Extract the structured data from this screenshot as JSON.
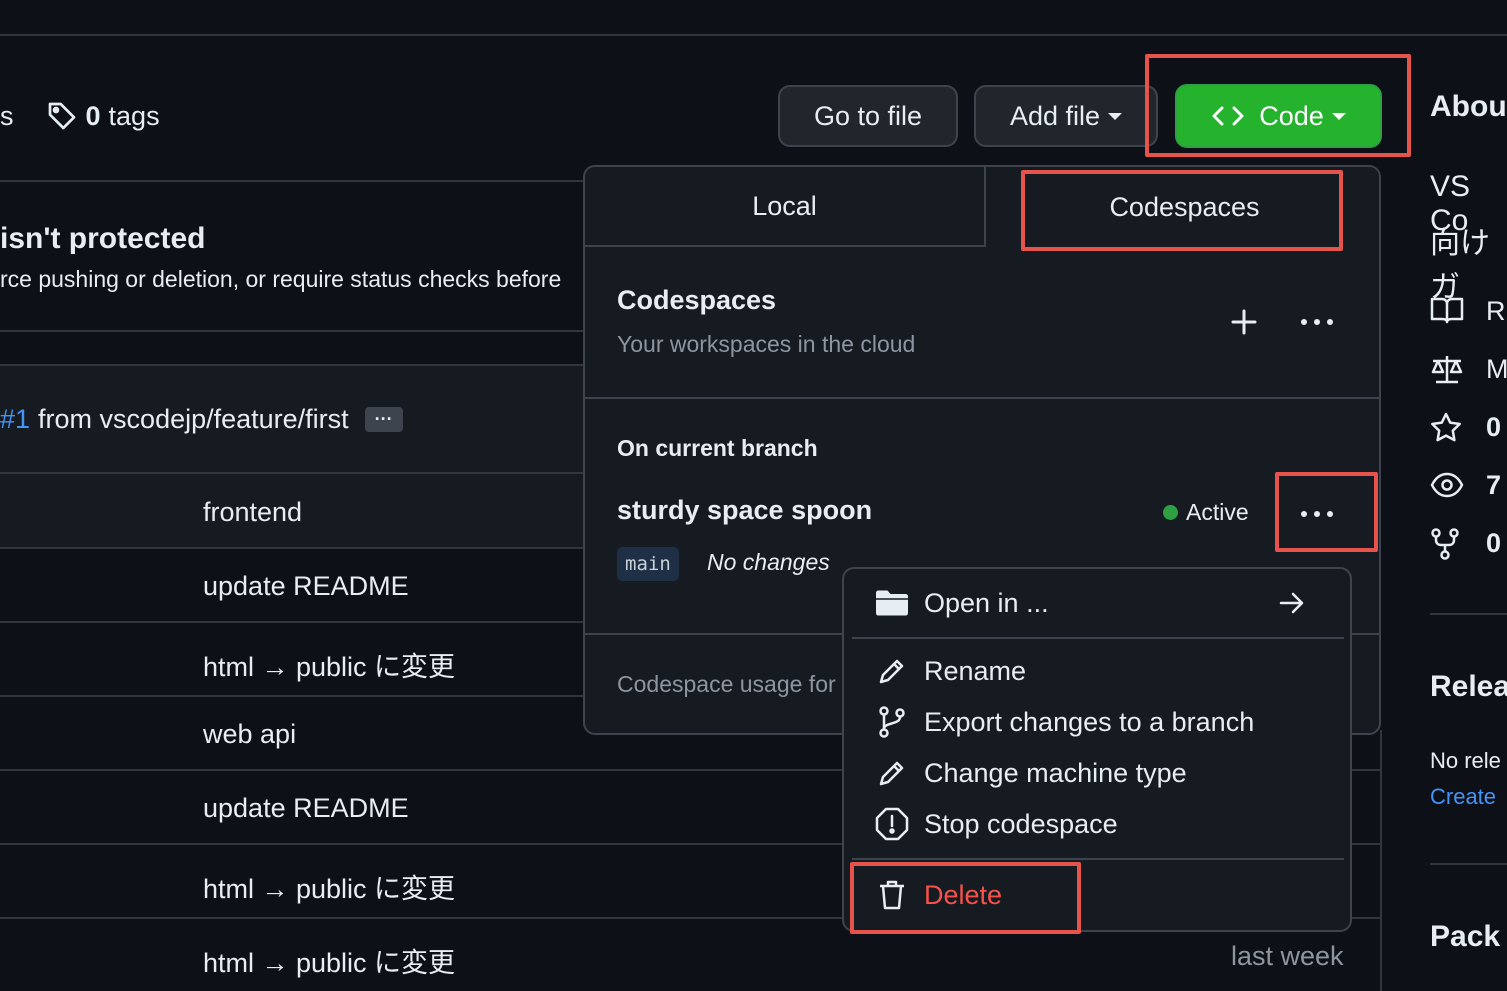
{
  "header": {
    "s_fragment": "s",
    "tags_count": "0",
    "tags_label": "tags"
  },
  "toolbar": {
    "goto_label": "Go to file",
    "add_file_label": "Add file",
    "code_label": "Code"
  },
  "branch_notice": {
    "title": "isn't protected",
    "desc": "rce pushing or deletion, or require status checks before"
  },
  "commit_bar": {
    "pr_ref": "#1",
    "from_text": "from vscodejp/feature/first",
    "ellipsis": "···"
  },
  "file_rows": [
    {
      "message": "frontend",
      "time": ""
    },
    {
      "message": "update README",
      "time": ""
    },
    {
      "message": "html → public に変更",
      "time": ""
    },
    {
      "message": "web api",
      "time": ""
    },
    {
      "message": "update README",
      "time": ""
    },
    {
      "message": "html → public に変更",
      "time": ""
    },
    {
      "message": "html → public に変更",
      "time": "last week"
    }
  ],
  "code_panel": {
    "tabs": {
      "local": "Local",
      "codespaces": "Codespaces"
    },
    "title": "Codespaces",
    "subtitle": "Your workspaces in the cloud",
    "section_title": "On current branch",
    "codespace": {
      "name": "sturdy space spoon",
      "status": "Active",
      "branch": "main",
      "changes": "No changes"
    },
    "usage_text": "Codespace usage for"
  },
  "context_menu": {
    "open_in": "Open in ...",
    "rename": "Rename",
    "export": "Export changes to a branch",
    "change_machine": "Change machine type",
    "stop": "Stop codespace",
    "delete": "Delete"
  },
  "about": {
    "title": "Abou",
    "desc_line1": "VS Co",
    "desc_line2": "向けガ",
    "readme": "R",
    "license": "M",
    "stars": "0",
    "watchers": "7",
    "forks": "0",
    "releases_title": "Relea",
    "no_releases": "No rele",
    "create_link": "Create",
    "packages_title": "Pack"
  },
  "colors": {
    "background": "#0d1117",
    "code_button": "#25b32e",
    "highlight": "#e5534b",
    "active_dot": "#2ea043",
    "link": "#4493f8",
    "danger": "#f85149"
  }
}
